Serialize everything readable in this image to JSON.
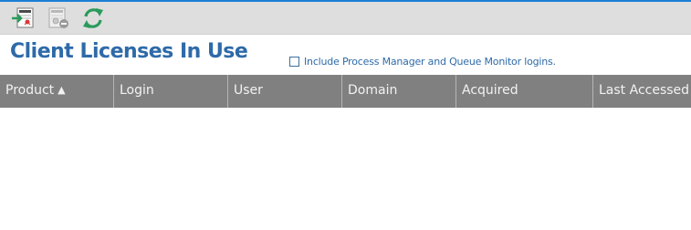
{
  "toolbar": {
    "buttons": [
      {
        "name": "import-license",
        "icon": "import-icon",
        "enabled": true
      },
      {
        "name": "release-license",
        "icon": "release-license-icon",
        "enabled": false
      },
      {
        "name": "refresh",
        "icon": "refresh-icon",
        "enabled": true
      }
    ]
  },
  "page": {
    "title": "Client Licenses In Use"
  },
  "include_option": {
    "label": "Include Process Manager and Queue Monitor logins.",
    "checked": false
  },
  "table": {
    "columns": [
      {
        "label": "Product",
        "sorted": "ascending"
      },
      {
        "label": "Login"
      },
      {
        "label": "User"
      },
      {
        "label": "Domain"
      },
      {
        "label": "Acquired"
      },
      {
        "label": "Last Accessed"
      }
    ],
    "sort_indicator": "▲",
    "rows": []
  },
  "colors": {
    "accent": "#1a7fd6",
    "title": "#2e6aa8",
    "header_bg": "#808080",
    "toolbar_bg": "#dedede",
    "refresh": "#2a9a5a"
  }
}
